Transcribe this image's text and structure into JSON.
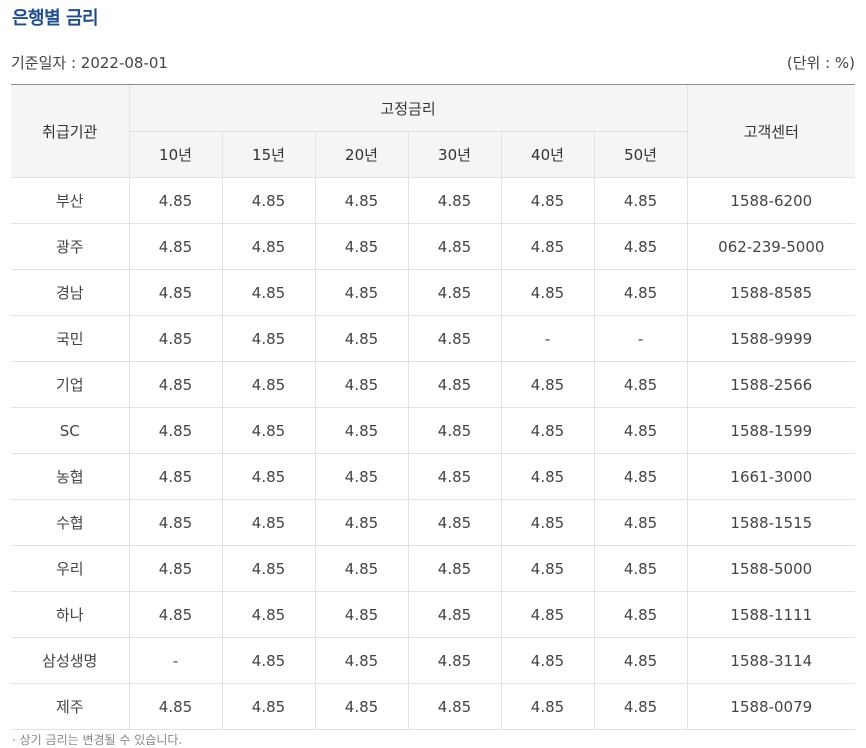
{
  "title": "은행별 금리",
  "base_date": "기준일자 : 2022-08-01",
  "unit": "(단위 : %)",
  "table": {
    "col_institution": "취급기관",
    "col_fixed": "고정금리",
    "col_center": "고객센터",
    "terms": [
      "10년",
      "15년",
      "20년",
      "30년",
      "40년",
      "50년"
    ],
    "rows": [
      {
        "bank": "부산",
        "rates": [
          "4.85",
          "4.85",
          "4.85",
          "4.85",
          "4.85",
          "4.85"
        ],
        "phone": "1588-6200"
      },
      {
        "bank": "광주",
        "rates": [
          "4.85",
          "4.85",
          "4.85",
          "4.85",
          "4.85",
          "4.85"
        ],
        "phone": "062-239-5000"
      },
      {
        "bank": "경남",
        "rates": [
          "4.85",
          "4.85",
          "4.85",
          "4.85",
          "4.85",
          "4.85"
        ],
        "phone": "1588-8585"
      },
      {
        "bank": "국민",
        "rates": [
          "4.85",
          "4.85",
          "4.85",
          "4.85",
          "-",
          "-"
        ],
        "phone": "1588-9999"
      },
      {
        "bank": "기업",
        "rates": [
          "4.85",
          "4.85",
          "4.85",
          "4.85",
          "4.85",
          "4.85"
        ],
        "phone": "1588-2566"
      },
      {
        "bank": "SC",
        "rates": [
          "4.85",
          "4.85",
          "4.85",
          "4.85",
          "4.85",
          "4.85"
        ],
        "phone": "1588-1599"
      },
      {
        "bank": "농협",
        "rates": [
          "4.85",
          "4.85",
          "4.85",
          "4.85",
          "4.85",
          "4.85"
        ],
        "phone": "1661-3000"
      },
      {
        "bank": "수협",
        "rates": [
          "4.85",
          "4.85",
          "4.85",
          "4.85",
          "4.85",
          "4.85"
        ],
        "phone": "1588-1515"
      },
      {
        "bank": "우리",
        "rates": [
          "4.85",
          "4.85",
          "4.85",
          "4.85",
          "4.85",
          "4.85"
        ],
        "phone": "1588-5000"
      },
      {
        "bank": "하나",
        "rates": [
          "4.85",
          "4.85",
          "4.85",
          "4.85",
          "4.85",
          "4.85"
        ],
        "phone": "1588-1111"
      },
      {
        "bank": "삼성생명",
        "rates": [
          "-",
          "4.85",
          "4.85",
          "4.85",
          "4.85",
          "4.85"
        ],
        "phone": "1588-3114"
      },
      {
        "bank": "제주",
        "rates": [
          "4.85",
          "4.85",
          "4.85",
          "4.85",
          "4.85",
          "4.85"
        ],
        "phone": "1588-0079"
      }
    ]
  },
  "footnote": "· 상기 금리는 변경될 수 있습니다."
}
